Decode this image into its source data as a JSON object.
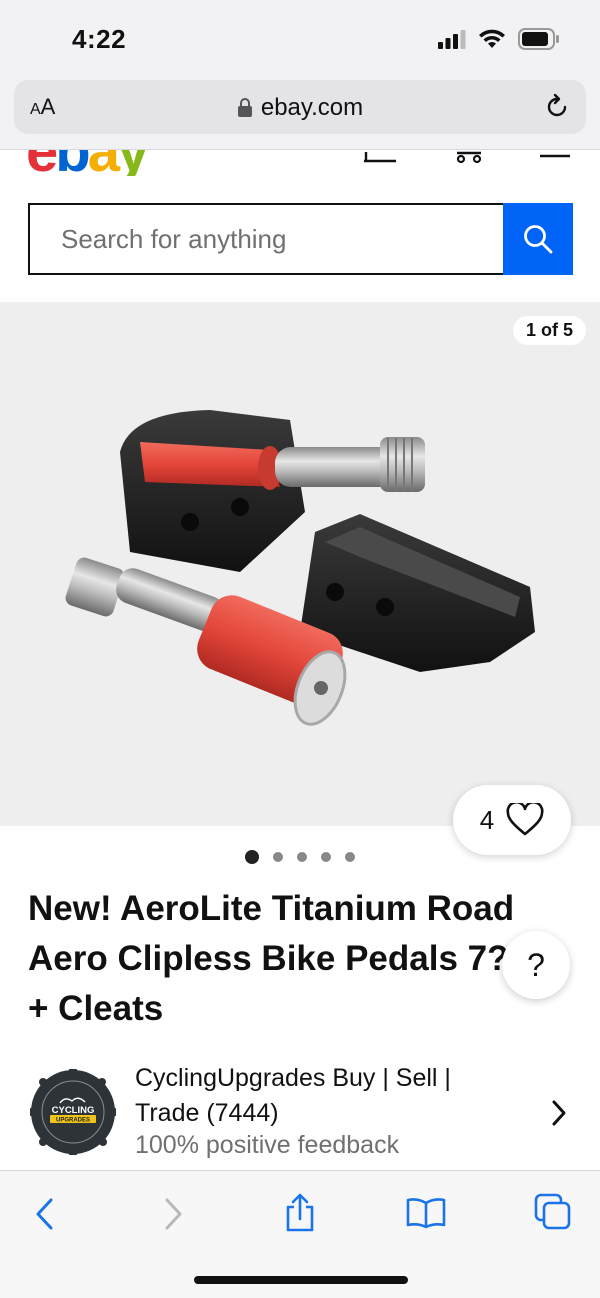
{
  "status": {
    "time": "4:22"
  },
  "browser": {
    "text_size_label": "AA",
    "url": "ebay.com"
  },
  "header": {
    "logo": [
      "e",
      "b",
      "a",
      "y"
    ]
  },
  "search": {
    "placeholder": "Search for anything"
  },
  "gallery": {
    "counter": "1 of 5",
    "total": 5,
    "active_index": 0
  },
  "watch": {
    "count": "4"
  },
  "listing": {
    "title": "New! AeroLite Titanium Road\nAero Clipless Bike Pedals 7?\n+ Cleats"
  },
  "help": {
    "label": "?"
  },
  "seller": {
    "name": "CyclingUpgrades Buy | Sell | Trade (7444)",
    "feedback": "100% positive feedback",
    "logo_text": "CYCLING UPGRADES"
  },
  "toolbar": {
    "items": [
      "back-icon",
      "forward-icon",
      "share-icon",
      "bookmarks-icon",
      "tabs-icon"
    ]
  },
  "colors": {
    "search_button": "#0064f7",
    "ebay_red": "#e53238",
    "ebay_blue": "#0064d2",
    "ebay_yellow": "#f5af02",
    "ebay_green": "#86b817",
    "ios_blue": "#1a73e8"
  }
}
